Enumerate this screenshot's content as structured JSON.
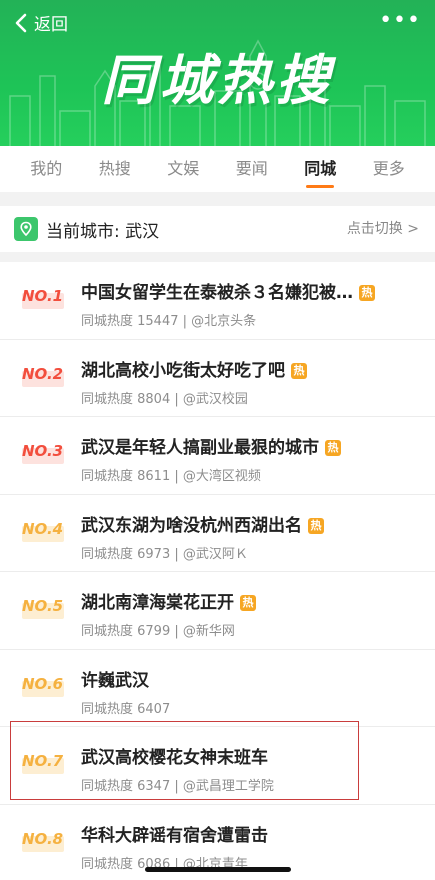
{
  "header": {
    "back_label": "返回",
    "more_label": "•••",
    "banner_title": "同城热搜"
  },
  "tabs": [
    {
      "label": "我的",
      "active": false
    },
    {
      "label": "热搜",
      "active": false
    },
    {
      "label": "文娱",
      "active": false
    },
    {
      "label": "要闻",
      "active": false
    },
    {
      "label": "同城",
      "active": true
    },
    {
      "label": "更多",
      "active": false
    }
  ],
  "city": {
    "label": "当前城市: 武汉",
    "switch_label": "点击切换 >"
  },
  "list": [
    {
      "rank": "NO.1",
      "title": "中国女留学生在泰被杀３名嫌犯被…",
      "hot": "热",
      "meta": "同城热度 15447 | @北京头条"
    },
    {
      "rank": "NO.2",
      "title": "湖北高校小吃街太好吃了吧",
      "hot": "热",
      "meta": "同城热度 8804 | @武汉校园"
    },
    {
      "rank": "NO.3",
      "title": "武汉是年轻人搞副业最狠的城市",
      "hot": "热",
      "meta": "同城热度 8611 | @大湾区视频"
    },
    {
      "rank": "NO.4",
      "title": "武汉东湖为啥没杭州西湖出名",
      "hot": "热",
      "meta": "同城热度 6973 | @武汉阿Ｋ"
    },
    {
      "rank": "NO.5",
      "title": "湖北南漳海棠花正开",
      "hot": "热",
      "meta": "同城热度 6799 | @新华网"
    },
    {
      "rank": "NO.6",
      "title": "许巍武汉",
      "hot": "",
      "meta": "同城热度 6407"
    },
    {
      "rank": "NO.7",
      "title": "武汉高校樱花女神末班车",
      "hot": "",
      "meta": "同城热度 6347 | @武昌理工学院"
    },
    {
      "rank": "NO.8",
      "title": "华科大辟谣有宿舍遭雷击",
      "hot": "",
      "meta": "同城热度 6086 | @北京青年"
    }
  ],
  "colors": {
    "header_green": "#1ec457",
    "active_tab_underline": "#ff7a16",
    "rank_top": "#f24e3d",
    "rank_low": "#f5b140",
    "hot_badge": "#f6a623",
    "highlight_box": "#c93d3d"
  },
  "icons": {
    "back": "chevron-left-icon",
    "more": "more-dots-icon",
    "city": "map-pin-icon"
  }
}
